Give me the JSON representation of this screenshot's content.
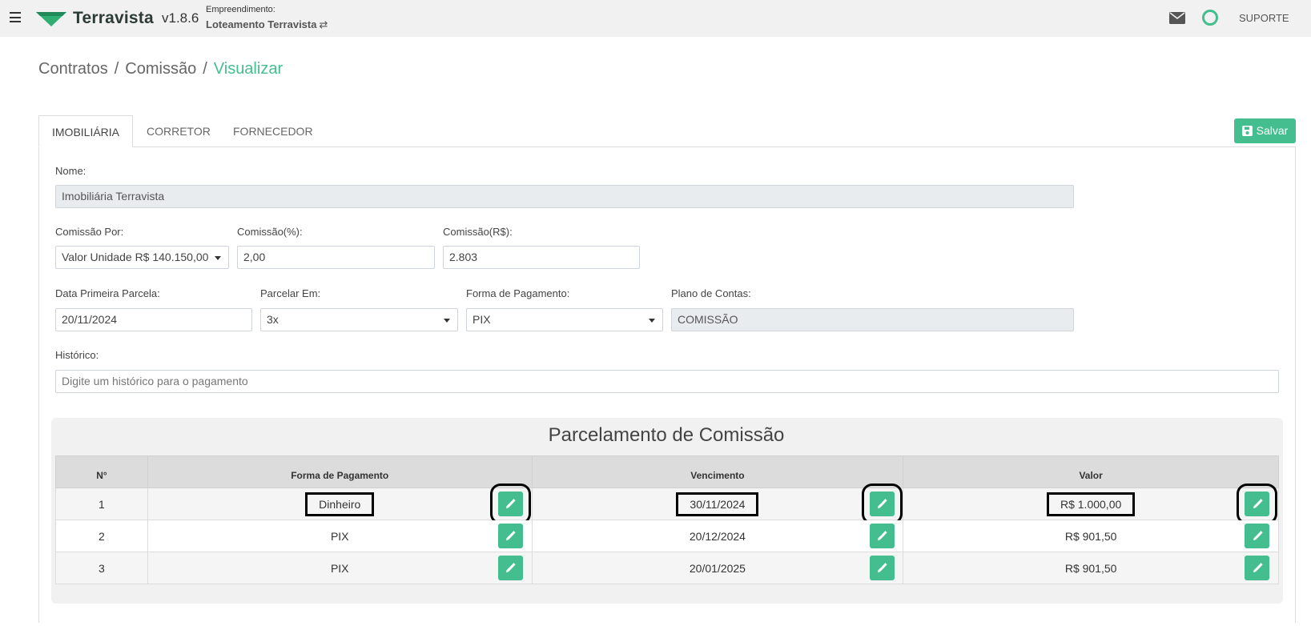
{
  "header": {
    "brand": "Terravista",
    "version": "v1.8.6",
    "empreendimento_label": "Empreendimento:",
    "empreendimento_value": "Loteamento Terravista",
    "swap_glyph": "⇄",
    "support_label": "SUPORTE",
    "accent_color": "#44bd8f"
  },
  "breadcrumb": {
    "items": [
      "Contratos",
      "Comissão"
    ],
    "separator": "/",
    "current": "Visualizar"
  },
  "tabs": [
    {
      "label": "IMOBILIÁRIA",
      "active": true
    },
    {
      "label": "CORRETOR",
      "active": false
    },
    {
      "label": "FORNECEDOR",
      "active": false
    }
  ],
  "save_button": {
    "label": "Salvar",
    "icon": "floppy-disk-icon"
  },
  "form": {
    "nome": {
      "label": "Nome:",
      "value": "Imobiliária Terravista"
    },
    "comissao_por": {
      "label": "Comissão Por:",
      "value": "Valor Unidade R$ 140.150,00"
    },
    "comissao_pct": {
      "label": "Comissão(%):",
      "value": "2,00"
    },
    "comissao_rs": {
      "label": "Comissão(R$):",
      "value": "2.803"
    },
    "data_primeira": {
      "label": "Data Primeira Parcela:",
      "value": "20/11/2024"
    },
    "parcelar_em": {
      "label": "Parcelar Em:",
      "value": "3x"
    },
    "forma_pagamento": {
      "label": "Forma de Pagamento:",
      "value": "PIX"
    },
    "plano_contas": {
      "label": "Plano de Contas:",
      "value": "COMISSÃO"
    },
    "historico": {
      "label": "Histórico:",
      "placeholder": "Digite um histórico para o pagamento"
    }
  },
  "parcelamento": {
    "title": "Parcelamento de Comissão",
    "columns": [
      "N°",
      "Forma de Pagamento",
      "Vencimento",
      "Valor"
    ],
    "rows": [
      {
        "n": "1",
        "forma": "Dinheiro",
        "vencimento": "30/11/2024",
        "valor": "R$ 1.000,00"
      },
      {
        "n": "2",
        "forma": "PIX",
        "vencimento": "20/12/2024",
        "valor": "R$ 901,50"
      },
      {
        "n": "3",
        "forma": "PIX",
        "vencimento": "20/01/2025",
        "valor": "R$ 901,50"
      }
    ],
    "edit_icon": "pencil-icon"
  }
}
